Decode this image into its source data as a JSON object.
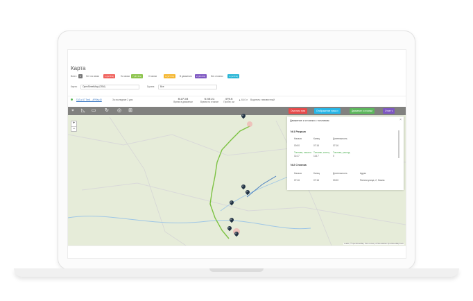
{
  "app": {
    "title": "Карта"
  },
  "filters": [
    {
      "label": "Всего",
      "badge": "8",
      "color": "#777777"
    },
    {
      "label": "Нет на связи",
      "badge": "1 (12.5%)",
      "color": "#f0625d"
    },
    {
      "label": "На связи",
      "badge": "7 (87.5%)",
      "color": "#8bc34a"
    },
    {
      "label": "Стоянки",
      "badge": "3 (37.5%)",
      "color": "#f5b731"
    },
    {
      "label": "В движении",
      "badge": "2 (25.0%)",
      "color": "#7e57c2"
    },
    {
      "label": "Без стоянок",
      "badge": "1 (12.5%)",
      "color": "#29b6d6"
    }
  ],
  "selects": {
    "map_label": "Карта:",
    "map_value": "OpenStreetMap (OSM)",
    "group_label": "Группа:",
    "group_value": "Все"
  },
  "vehicle": {
    "name": "ГАЗ-с 67 Тип1 - АРВ№40",
    "period": "За последние 2 дня",
    "stats": [
      {
        "value": "8:27:34",
        "label": "Время в движении"
      },
      {
        "value": "6:40:21",
        "label": "Время на стоянке"
      },
      {
        "value": "479.6",
        "label": "Пробег, км"
      }
    ],
    "speed": "64.0 л",
    "driver": "Водитель: неизвестный"
  },
  "toolbar": {
    "icons": [
      "location-icon",
      "ruler-icon",
      "truck-icon",
      "refresh-icon",
      "globe-icon",
      "grid-icon"
    ],
    "buttons": [
      {
        "label": "Очистить трек",
        "color": "#e84a4a"
      },
      {
        "label": "Отображение трека ▾",
        "color": "#26b7e8"
      },
      {
        "label": "Движение и стоянки",
        "color": "#5cb85c"
      },
      {
        "label": "Отчет ▾",
        "color": "#7e57c2"
      }
    ]
  },
  "panel": {
    "title": "Движение и стоянки с топливом",
    "section1": {
      "title": "№1 Разрыв",
      "headers": [
        "Начало",
        "Конец",
        "Длительность"
      ],
      "rows": [
        [
          "00:00",
          "07:16",
          "07:16"
        ],
        [
          "Топливо, начало:",
          "Топливо, конец:",
          "Топливо, расход:"
        ],
        [
          "114.7",
          "114.7",
          "0"
        ]
      ]
    },
    "section2": {
      "title": "№2 Стоянка",
      "headers": [
        "Начало",
        "Конец",
        "Длительность",
        "Адрес"
      ],
      "rows": [
        [
          "07:16",
          "07:16",
          "00:00",
          "Пятина улица, 2, Няжна"
        ]
      ]
    }
  },
  "map": {
    "zoom_in": "+",
    "zoom_out": "−",
    "attribution": "Leaflet | © OpenStreetMap, Tiles courtesy of Humanitarian OpenStreetMap Team",
    "pins": [
      "P",
      "P",
      "P",
      "P",
      "P",
      "P",
      "P"
    ]
  }
}
